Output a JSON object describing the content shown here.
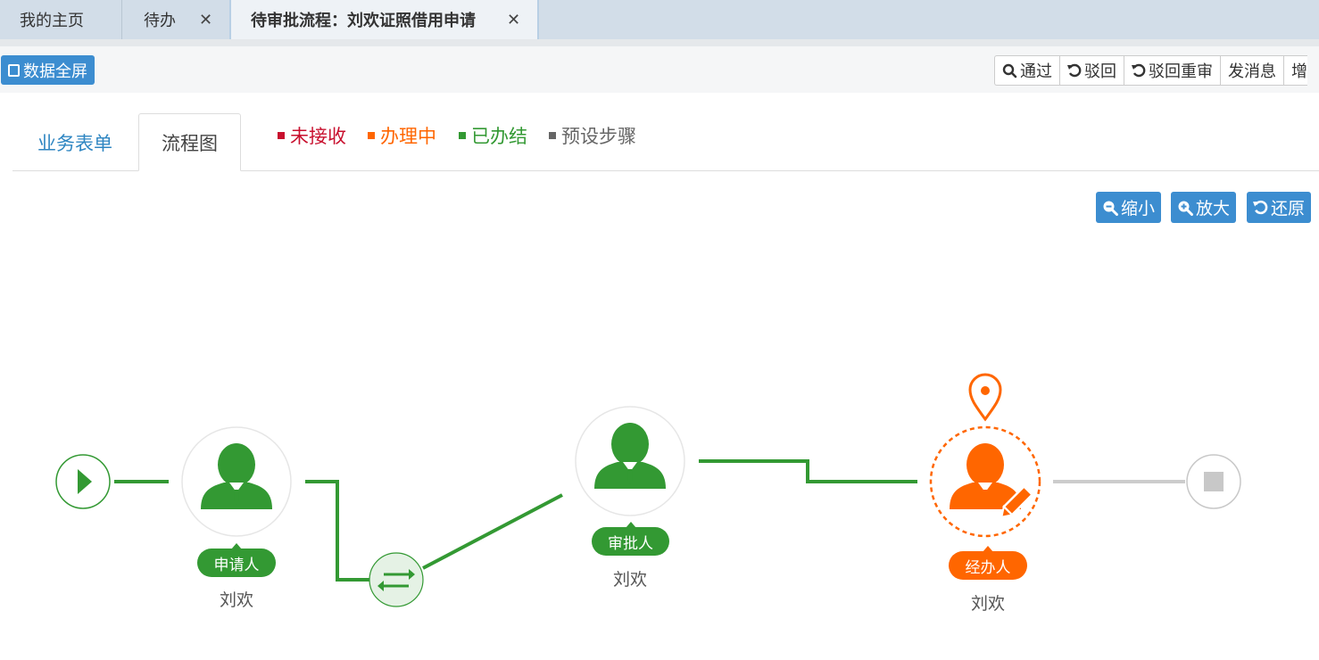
{
  "tabs": [
    {
      "label": "我的主页",
      "closable": false
    },
    {
      "label": "待办",
      "closable": true
    },
    {
      "label": "待审批流程：刘欢证照借用申请",
      "closable": true,
      "active": true
    }
  ],
  "close_glyph": "✕",
  "toolbar": {
    "fullscreen_label": "数据全屏",
    "actions": [
      "通过",
      "驳回",
      "驳回重审",
      "发消息",
      "增"
    ]
  },
  "content_tabs": {
    "form": "业务表单",
    "flow": "流程图"
  },
  "legend": [
    {
      "label": "未接收",
      "color": "#c8102e"
    },
    {
      "label": "办理中",
      "color": "#ff6600"
    },
    {
      "label": "已办结",
      "color": "#339933"
    },
    {
      "label": "预设步骤",
      "color": "#666666"
    }
  ],
  "zoom": {
    "out": "缩小",
    "in": "放大",
    "reset": "还原"
  },
  "flow": {
    "nodes": [
      {
        "role": "申请人",
        "person": "刘欢",
        "status": "done"
      },
      {
        "role": "审批人",
        "person": "刘欢",
        "status": "done"
      },
      {
        "role": "经办人",
        "person": "刘欢",
        "status": "in-progress"
      }
    ]
  },
  "colors": {
    "done": "#339933",
    "current": "#ff6600",
    "pending": "#cccccc",
    "primary": "#3c8dd0"
  },
  "icons": [
    "play-icon",
    "user-icon",
    "switch-icon",
    "location-pin-icon",
    "edit-icon",
    "stop-icon",
    "search-icon",
    "undo-icon",
    "zoom-out-icon",
    "zoom-in-icon"
  ]
}
